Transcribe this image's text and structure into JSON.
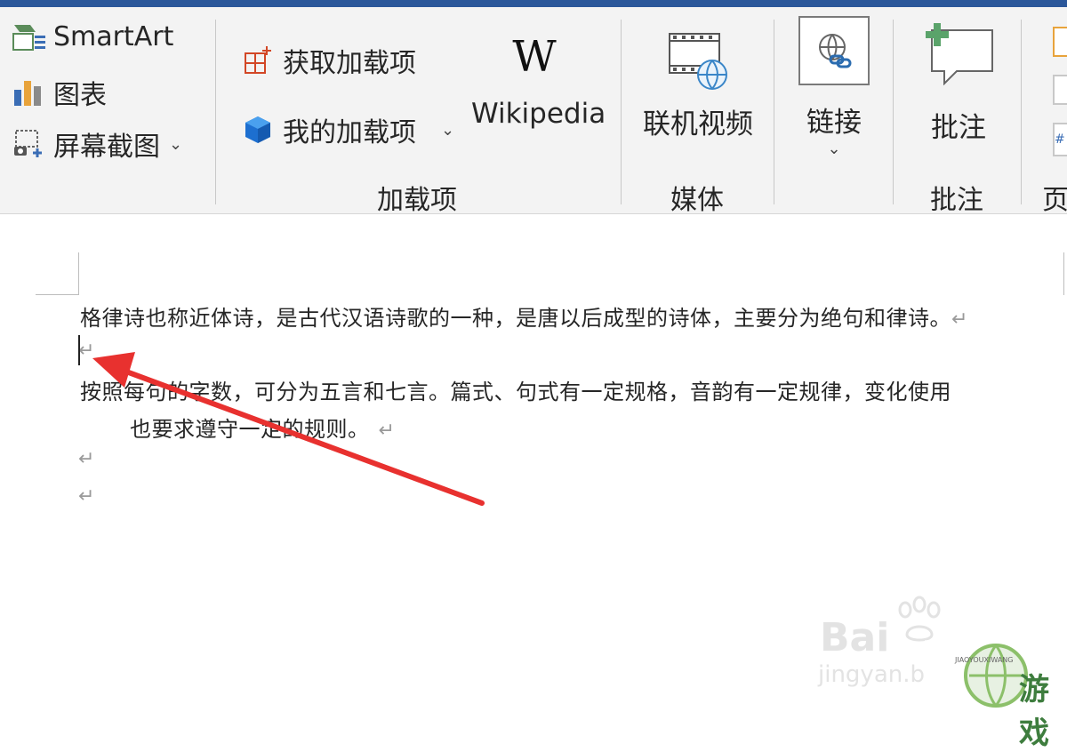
{
  "ribbon": {
    "illustrations": {
      "smartart_label": "SmartArt",
      "chart_label": "图表",
      "screenshot_label": "屏幕截图"
    },
    "addins": {
      "get_addins_label": "获取加载项",
      "my_addins_label": "我的加载项",
      "wikipedia_label": "Wikipedia",
      "group_label": "加载项"
    },
    "media": {
      "online_video_label": "联机视频",
      "group_label": "媒体"
    },
    "links": {
      "link_label": "链接"
    },
    "comments": {
      "comment_label": "批注",
      "group_label": "批注"
    },
    "header_footer": {
      "group_label": "页"
    }
  },
  "document": {
    "paragraphs": [
      "格律诗也称近体诗，是古代汉语诗歌的一种，是唐以后成型的诗体，主要分为绝句和律诗。",
      "按照每句的字数，可分为五言和七言。篇式、句式有一定规格，音韵有一定规律，变化使用",
      "也要求遵守一定的规则。"
    ],
    "paragraph_mark": "↵"
  },
  "watermark": {
    "brand": "Bai",
    "sub": "jingyan.b",
    "logo_text": "游戏",
    "logo_sub": "JIAOYOUXIWANG"
  },
  "colors": {
    "title_bar": "#2b579a",
    "ribbon_bg": "#f3f3f3",
    "annotation_arrow": "#e8312f"
  }
}
